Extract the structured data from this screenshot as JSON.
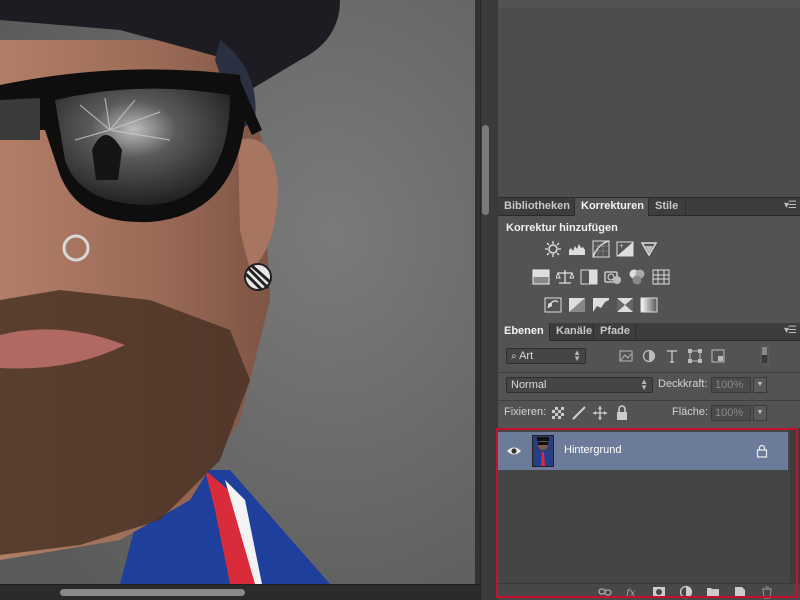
{
  "panels": {
    "adjustments_tabs": [
      "Bibliotheken",
      "Korrekturen",
      "Stile"
    ],
    "adjustments_active_tab": "Korrekturen",
    "adjustments_title": "Korrektur hinzufügen",
    "adjustment_icons_row1": [
      "brightness-contrast-icon",
      "levels-icon",
      "curves-icon",
      "exposure-icon",
      "vibrance-icon"
    ],
    "adjustment_icons_row2": [
      "hue-saturation-icon",
      "color-balance-icon",
      "black-white-icon",
      "photo-filter-icon",
      "channel-mixer-icon",
      "color-lookup-icon"
    ],
    "adjustment_icons_row3": [
      "invert-icon",
      "posterize-icon",
      "threshold-icon",
      "selective-color-icon",
      "gradient-map-icon"
    ],
    "layers_tabs": [
      "Ebenen",
      "Kanäle",
      "Pfade"
    ],
    "layers_active_tab": "Ebenen"
  },
  "layers": {
    "filter_kind": "Art",
    "blend_mode": "Normal",
    "opacity_label": "Deckkraft:",
    "opacity_value": "100%",
    "lock_label": "Fixieren:",
    "fill_label": "Fläche:",
    "fill_value": "100%",
    "items": [
      {
        "name": "Hintergrund",
        "visible": true,
        "locked": true,
        "selected": true
      }
    ],
    "footer_icons": [
      "link-layers-icon",
      "fx-icon",
      "add-mask-icon",
      "new-adjustment-icon",
      "new-group-icon",
      "new-layer-icon",
      "delete-icon"
    ]
  },
  "colors": {
    "panel_bg": "#535353",
    "layer_selected": "#6b7b99",
    "highlight_frame": "#c8102e"
  }
}
